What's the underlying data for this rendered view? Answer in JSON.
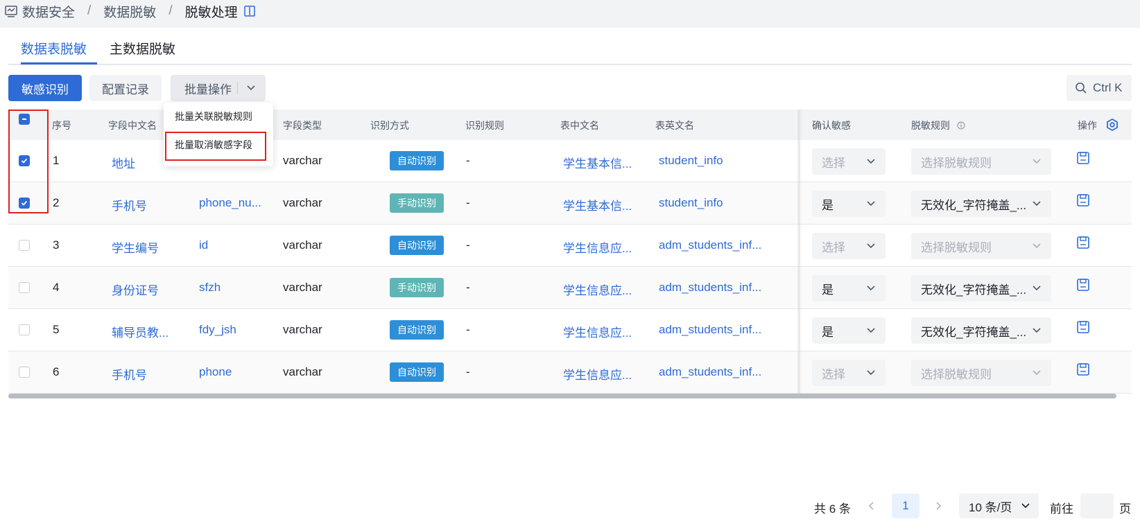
{
  "breadcrumb": {
    "items": [
      "数据安全",
      "数据脱敏",
      "脱敏处理"
    ],
    "separator": "/"
  },
  "tabs": [
    {
      "label": "数据表脱敏",
      "active": true
    },
    {
      "label": "主数据脱敏",
      "active": false
    }
  ],
  "toolbar": {
    "identify_label": "敏感识别",
    "records_label": "配置记录",
    "batch_label": "批量操作",
    "search_shortcut": "Ctrl K"
  },
  "batch_menu": {
    "items": [
      "批量关联脱敏规则",
      "批量取消敏感字段"
    ]
  },
  "table": {
    "headers": {
      "index": "序号",
      "cn_name": "字段中文名",
      "field_type": "字段类型",
      "method": "识别方式",
      "rule": "识别规则",
      "table_cn": "表中文名",
      "table_en": "表英文名",
      "confirm": "确认敏感",
      "mask_rule": "脱敏规则",
      "action": "操作"
    },
    "rows": [
      {
        "checked": true,
        "index": "1",
        "cn_name": "地址",
        "en_name": "",
        "type": "varchar",
        "method": "自动识别",
        "method_kind": "auto",
        "rule": "-",
        "table_cn": "学生基本信...",
        "table_en": "student_info",
        "confirm": "选择",
        "confirm_placeholder": true,
        "mask": "选择脱敏规则",
        "mask_placeholder": true
      },
      {
        "checked": true,
        "index": "2",
        "cn_name": "手机号",
        "en_name": "phone_nu...",
        "type": "varchar",
        "method": "手动识别",
        "method_kind": "manual",
        "rule": "-",
        "table_cn": "学生基本信...",
        "table_en": "student_info",
        "confirm": "是",
        "confirm_placeholder": false,
        "mask": "无效化_字符掩盖_...",
        "mask_placeholder": false
      },
      {
        "checked": false,
        "index": "3",
        "cn_name": "学生编号",
        "en_name": "id",
        "type": "varchar",
        "method": "自动识别",
        "method_kind": "auto",
        "rule": "-",
        "table_cn": "学生信息应...",
        "table_en": "adm_students_inf...",
        "confirm": "选择",
        "confirm_placeholder": true,
        "mask": "选择脱敏规则",
        "mask_placeholder": true
      },
      {
        "checked": false,
        "index": "4",
        "cn_name": "身份证号",
        "en_name": "sfzh",
        "type": "varchar",
        "method": "手动识别",
        "method_kind": "manual",
        "rule": "-",
        "table_cn": "学生信息应...",
        "table_en": "adm_students_inf...",
        "confirm": "是",
        "confirm_placeholder": false,
        "mask": "无效化_字符掩盖_...",
        "mask_placeholder": false
      },
      {
        "checked": false,
        "index": "5",
        "cn_name": "辅导员教...",
        "en_name": "fdy_jsh",
        "type": "varchar",
        "method": "自动识别",
        "method_kind": "auto",
        "rule": "-",
        "table_cn": "学生信息应...",
        "table_en": "adm_students_inf...",
        "confirm": "是",
        "confirm_placeholder": false,
        "mask": "无效化_字符掩盖_...",
        "mask_placeholder": false
      },
      {
        "checked": false,
        "index": "6",
        "cn_name": "手机号",
        "en_name": "phone",
        "type": "varchar",
        "method": "自动识别",
        "method_kind": "auto",
        "rule": "-",
        "table_cn": "学生信息应...",
        "table_en": "adm_students_inf...",
        "confirm": "选择",
        "confirm_placeholder": true,
        "mask": "选择脱敏规则",
        "mask_placeholder": true
      }
    ]
  },
  "pagination": {
    "total": "共 6 条",
    "current_page": "1",
    "page_size": "10 条/页",
    "goto_prefix": "前往",
    "goto_suffix": "页"
  },
  "colors": {
    "primary": "#2e6bd6",
    "auto_tag": "#2d8fd8",
    "manual_tag": "#5fb5b5",
    "highlight": "#e02020"
  }
}
